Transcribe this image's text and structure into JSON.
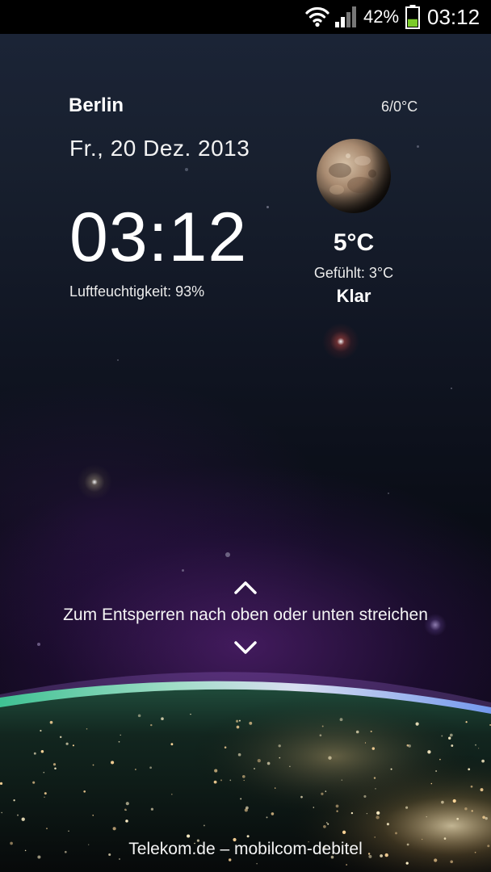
{
  "status_bar": {
    "battery_percent": "42%",
    "time": "03:12",
    "wifi_icon": "wifi-icon",
    "signal_icon": "signal-icon",
    "battery_icon": "battery-icon",
    "battery_level": 0.42,
    "battery_color": "#7ccc2a"
  },
  "widget": {
    "city": "Berlin",
    "temp_range": "6/0°C",
    "date": "Fr., 20 Dez. 2013",
    "time": "03:12",
    "humidity": "Luftfeuchtigkeit: 93%",
    "weather_icon": "moon-icon",
    "temperature": "5°C",
    "feels_like": "Gefühlt: 3°C",
    "condition": "Klar"
  },
  "lockscreen": {
    "unlock_hint": "Zum Entsperren nach oben oder unten streichen",
    "carrier": "Telekom.de – mobilcom-debitel"
  }
}
